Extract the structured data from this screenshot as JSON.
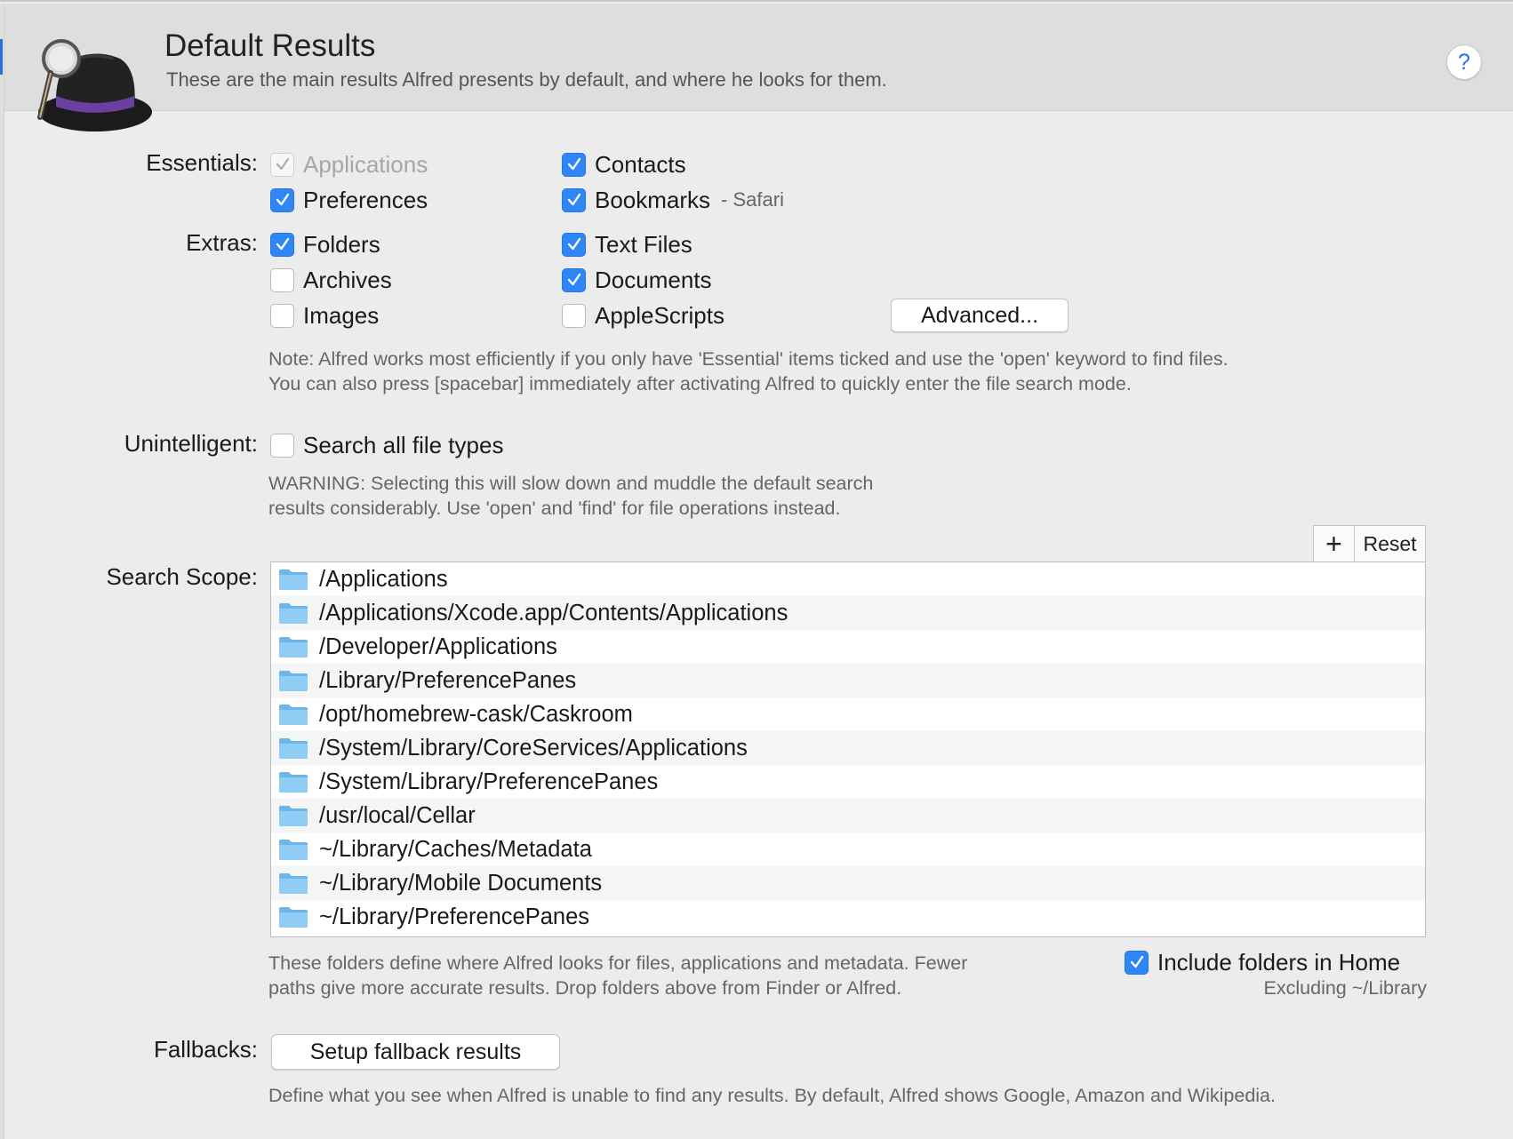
{
  "header": {
    "title": "Default Results",
    "subtitle": "These are the main results Alfred presents by default, and where he looks for them.",
    "help_label": "?"
  },
  "essentials": {
    "label": "Essentials:",
    "items": [
      {
        "label": "Applications",
        "checked": true,
        "disabled": true
      },
      {
        "label": "Contacts",
        "checked": true
      },
      {
        "label": "Preferences",
        "checked": true
      },
      {
        "label": "Bookmarks",
        "checked": true,
        "sub": "- Safari"
      }
    ]
  },
  "extras": {
    "label": "Extras:",
    "items": [
      {
        "label": "Folders",
        "checked": true
      },
      {
        "label": "Text Files",
        "checked": true
      },
      {
        "label": "Archives",
        "checked": false
      },
      {
        "label": "Documents",
        "checked": true
      },
      {
        "label": "Images",
        "checked": false
      },
      {
        "label": "AppleScripts",
        "checked": false
      }
    ],
    "advanced_label": "Advanced..."
  },
  "note": {
    "line1": "Note: Alfred works most efficiently if you only have 'Essential' items ticked and use the 'open' keyword to find files.",
    "line2": "You can also press [spacebar] immediately after activating Alfred to quickly enter the file search mode."
  },
  "unintelligent": {
    "label": "Unintelligent:",
    "option": "Search all file types",
    "checked": false,
    "warning1": "WARNING: Selecting this will slow down and muddle the default search",
    "warning2": "results considerably. Use 'open' and 'find' for file operations instead."
  },
  "search_scope": {
    "label": "Search Scope:",
    "add_label": "+",
    "reset_label": "Reset",
    "paths": [
      "/Applications",
      "/Applications/Xcode.app/Contents/Applications",
      "/Developer/Applications",
      "/Library/PreferencePanes",
      "/opt/homebrew-cask/Caskroom",
      "/System/Library/CoreServices/Applications",
      "/System/Library/PreferencePanes",
      "/usr/local/Cellar",
      "~/Library/Caches/Metadata",
      "~/Library/Mobile Documents",
      "~/Library/PreferencePanes"
    ],
    "footer1": "These folders define where Alfred looks for files, applications and metadata. Fewer",
    "footer2": "paths give more accurate results. Drop folders above from Finder or Alfred.",
    "include_home_label": "Include folders in Home",
    "include_home_checked": true,
    "excluding": "Excluding ~/Library"
  },
  "fallbacks": {
    "label": "Fallbacks:",
    "button_label": "Setup fallback results",
    "description": "Define what you see when Alfred is unable to find any results. By default, Alfred shows Google, Amazon and Wikipedia."
  },
  "colors": {
    "accent": "#2f86f6",
    "folder": "#7cc2f0"
  }
}
